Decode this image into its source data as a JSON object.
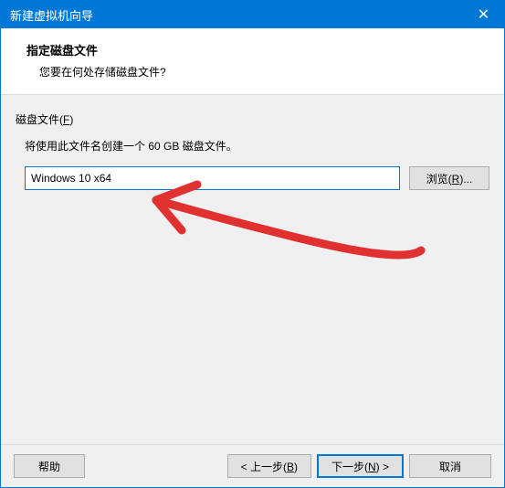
{
  "titlebar": {
    "title": "新建虚拟机向导"
  },
  "header": {
    "title": "指定磁盘文件",
    "subtitle": "您要在何处存储磁盘文件?"
  },
  "content": {
    "fieldset_label_prefix": "磁盘文件(",
    "fieldset_label_key": "F",
    "fieldset_label_suffix": ")",
    "description": "将使用此文件名创建一个 60 GB 磁盘文件。",
    "input_value": "Windows 10 x64",
    "browse_label_prefix": "浏览(",
    "browse_label_key": "R",
    "browse_label_suffix": ")..."
  },
  "footer": {
    "help_label": "帮助",
    "back_prefix": "< 上一步(",
    "back_key": "B",
    "back_suffix": ")",
    "next_prefix": "下一步(",
    "next_key": "N",
    "next_suffix": ") >",
    "cancel_label": "取消"
  }
}
